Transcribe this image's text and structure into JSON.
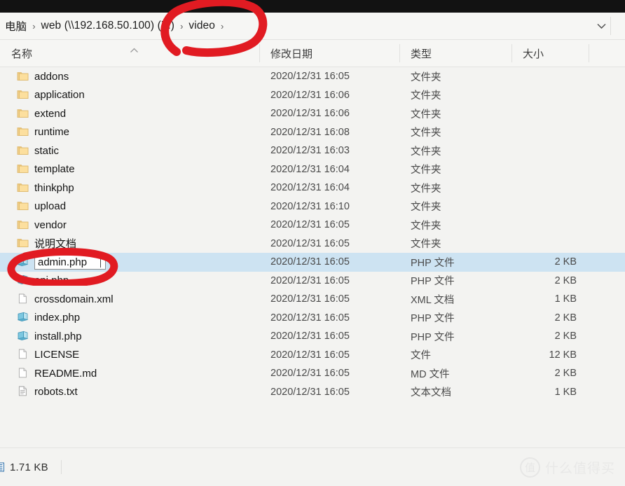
{
  "window": {
    "chrome_strip": ""
  },
  "addressbar": {
    "breadcrumbs": [
      {
        "label": "电脑",
        "sep": "›"
      },
      {
        "label": "web (\\\\192.168.50.100) (Z:)",
        "sep": "›"
      },
      {
        "label": "video",
        "sep": "›"
      }
    ],
    "dropdown_icon": "chevron-down-icon"
  },
  "columns": {
    "name": "名称",
    "date": "修改日期",
    "type": "类型",
    "size": "大小",
    "sort_indicator": "⌃"
  },
  "files": [
    {
      "name": "addons",
      "icon": "folder-icon",
      "date": "2020/12/31 16:05",
      "type": "文件夹",
      "size": "",
      "selected": false,
      "rename": false
    },
    {
      "name": "application",
      "icon": "folder-icon",
      "date": "2020/12/31 16:06",
      "type": "文件夹",
      "size": "",
      "selected": false,
      "rename": false
    },
    {
      "name": "extend",
      "icon": "folder-icon",
      "date": "2020/12/31 16:06",
      "type": "文件夹",
      "size": "",
      "selected": false,
      "rename": false
    },
    {
      "name": "runtime",
      "icon": "folder-icon",
      "date": "2020/12/31 16:08",
      "type": "文件夹",
      "size": "",
      "selected": false,
      "rename": false
    },
    {
      "name": "static",
      "icon": "folder-icon",
      "date": "2020/12/31 16:03",
      "type": "文件夹",
      "size": "",
      "selected": false,
      "rename": false
    },
    {
      "name": "template",
      "icon": "folder-icon",
      "date": "2020/12/31 16:04",
      "type": "文件夹",
      "size": "",
      "selected": false,
      "rename": false
    },
    {
      "name": "thinkphp",
      "icon": "folder-icon",
      "date": "2020/12/31 16:04",
      "type": "文件夹",
      "size": "",
      "selected": false,
      "rename": false
    },
    {
      "name": "upload",
      "icon": "folder-icon",
      "date": "2020/12/31 16:10",
      "type": "文件夹",
      "size": "",
      "selected": false,
      "rename": false
    },
    {
      "name": "vendor",
      "icon": "folder-icon",
      "date": "2020/12/31 16:05",
      "type": "文件夹",
      "size": "",
      "selected": false,
      "rename": false
    },
    {
      "name": "说明文档",
      "icon": "folder-icon",
      "date": "2020/12/31 16:05",
      "type": "文件夹",
      "size": "",
      "selected": false,
      "rename": false
    },
    {
      "name": "admin.php",
      "icon": "php-file-icon",
      "date": "2020/12/31 16:05",
      "type": "PHP 文件",
      "size": "2 KB",
      "selected": true,
      "rename": true
    },
    {
      "name": "api.php",
      "icon": "php-file-icon",
      "date": "2020/12/31 16:05",
      "type": "PHP 文件",
      "size": "2 KB",
      "selected": false,
      "rename": false
    },
    {
      "name": "crossdomain.xml",
      "icon": "blank-file-icon",
      "date": "2020/12/31 16:05",
      "type": "XML 文档",
      "size": "1 KB",
      "selected": false,
      "rename": false
    },
    {
      "name": "index.php",
      "icon": "php-file-icon",
      "date": "2020/12/31 16:05",
      "type": "PHP 文件",
      "size": "2 KB",
      "selected": false,
      "rename": false
    },
    {
      "name": "install.php",
      "icon": "php-file-icon",
      "date": "2020/12/31 16:05",
      "type": "PHP 文件",
      "size": "2 KB",
      "selected": false,
      "rename": false
    },
    {
      "name": "LICENSE",
      "icon": "blank-file-icon",
      "date": "2020/12/31 16:05",
      "type": "文件",
      "size": "12 KB",
      "selected": false,
      "rename": false
    },
    {
      "name": "README.md",
      "icon": "blank-file-icon",
      "date": "2020/12/31 16:05",
      "type": "MD 文件",
      "size": "2 KB",
      "selected": false,
      "rename": false
    },
    {
      "name": "robots.txt",
      "icon": "text-file-icon",
      "date": "2020/12/31 16:05",
      "type": "文本文档",
      "size": "1 KB",
      "selected": false,
      "rename": false
    }
  ],
  "statusbar": {
    "selection_size": "1.71 KB",
    "icon": "item-count-icon"
  },
  "watermark": {
    "badge": "值",
    "text": "什么值得买"
  },
  "annotations": {
    "color": "#e11b22",
    "items": [
      {
        "name": "circle-around-video-breadcrumb",
        "target": "video"
      },
      {
        "name": "circle-around-admin-php",
        "target": "admin.php"
      }
    ]
  }
}
